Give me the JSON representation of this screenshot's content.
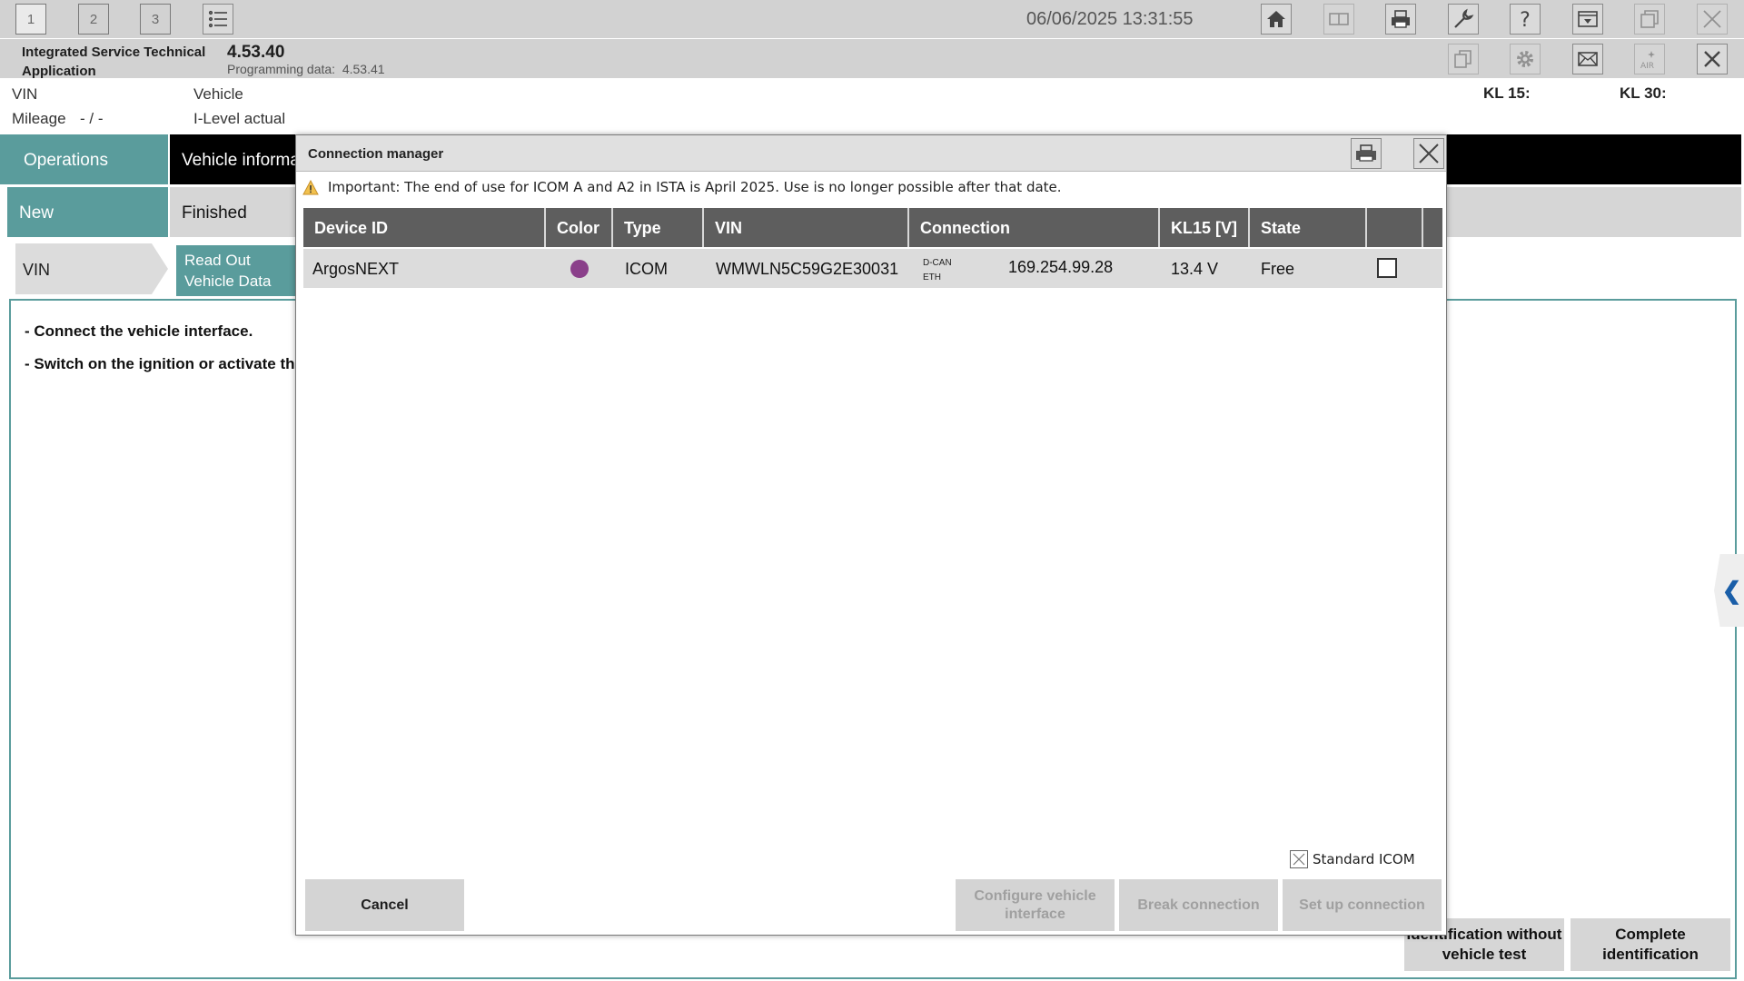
{
  "topbar": {
    "tabs": [
      "1",
      "2",
      "3"
    ],
    "datetime": "06/06/2025 13:31:55"
  },
  "app": {
    "title_line1": "Integrated Service Technical",
    "title_line2": "Application",
    "version": "4.53.40",
    "programming_label": "Programming data:",
    "programming_version": "4.53.41"
  },
  "vehicle_info": {
    "vin_label": "VIN",
    "mileage_label": "Mileage",
    "mileage_value": "- / -",
    "vehicle_label": "Vehicle",
    "ilevel_label": "I-Level actual",
    "kl15_label": "KL 15:",
    "kl30_label": "KL 30:"
  },
  "nav": {
    "operations": "Operations",
    "vehicle_information": "Vehicle informa",
    "new": "New",
    "finished": "Finished",
    "vin": "VIN",
    "read_out_line1": "Read Out",
    "read_out_line2": "Vehicle Data"
  },
  "content": {
    "instruction1": "- Connect the vehicle interface.",
    "instruction2": "- Switch on the ignition or activate the",
    "btn_ident_without_line1": "Identification without",
    "btn_ident_without_line2": "vehicle test",
    "btn_complete_line1": "Complete",
    "btn_complete_line2": "identification"
  },
  "dialog": {
    "title": "Connection manager",
    "warning": "Important: The end of use for ICOM A and A2 in ISTA is April 2025. Use is no longer possible after that date.",
    "columns": [
      "Device ID",
      "Color",
      "Type",
      "VIN",
      "Connection",
      "KL15 [V]",
      "State",
      "",
      ""
    ],
    "rows": [
      {
        "device_id": "ArgosNEXT",
        "color": "#8a3f8a",
        "type": "ICOM",
        "vin": "WMWLN5C59G2E30031",
        "conn_protocol1": "D-CAN",
        "conn_protocol2": "ETH",
        "ip": "169.254.99.28",
        "kl15": "13.4 V",
        "state": "Free",
        "selected": false
      }
    ],
    "standard_icom": "Standard ICOM",
    "cancel": "Cancel",
    "configure_line1": "Configure vehicle",
    "configure_line2": "interface",
    "break_connection": "Break connection",
    "setup_connection": "Set up connection"
  },
  "colors": {
    "teal": "#5a9c9c",
    "toolbar_gray": "#d2d2d2",
    "table_header": "#5e5e5e",
    "row_bg": "#dcdcdc",
    "link_blue": "#1a5ea8"
  },
  "icons": [
    "home-icon",
    "compare-icon",
    "print-icon",
    "wrench-icon",
    "help-icon",
    "dropdown-menu-icon",
    "window-icon",
    "close-icon",
    "copy-icon",
    "gear-icon",
    "mail-icon",
    "air-icon",
    "warning-icon",
    "chevron-left-icon",
    "checkbox-icon"
  ]
}
